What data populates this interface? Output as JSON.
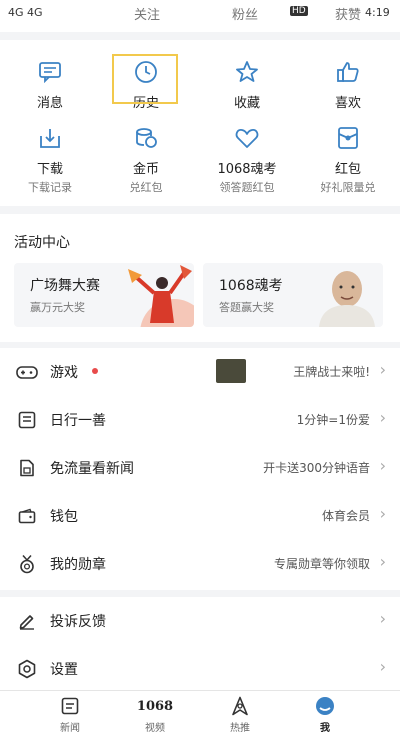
{
  "topbar": {
    "tabs": [
      "关注",
      "粉丝",
      "获赞"
    ],
    "status_left": "4G 4G",
    "status_right": "4:19",
    "hd": "HD"
  },
  "grid": {
    "row1": [
      {
        "label": "消息",
        "icon": "message-icon"
      },
      {
        "label": "历史",
        "icon": "clock-icon"
      },
      {
        "label": "收藏",
        "icon": "star-icon"
      },
      {
        "label": "喜欢",
        "icon": "thumbs-up-icon"
      }
    ],
    "row2": [
      {
        "label": "下载",
        "sub": "下载记录",
        "icon": "download-icon"
      },
      {
        "label": "金币",
        "sub": "兑红包",
        "icon": "coins-icon"
      },
      {
        "label": "1068魂考",
        "sub": "领答题红包",
        "icon": "heart-icon"
      },
      {
        "label": "红包",
        "sub": "好礼限量兑",
        "icon": "red-packet-icon"
      }
    ]
  },
  "activity": {
    "title": "活动中心",
    "cards": [
      {
        "title": "广场舞大赛",
        "sub": "赢万元大奖"
      },
      {
        "title": "1068魂考",
        "sub": "答题赢大奖"
      }
    ]
  },
  "list1": [
    {
      "label": "游戏",
      "value": "王牌战士来啦!",
      "icon": "gamepad-icon"
    },
    {
      "label": "日行一善",
      "value": "1分钟=1份爱",
      "icon": "charity-icon"
    },
    {
      "label": "免流量看新闻",
      "value": "开卡送300分钟语音",
      "icon": "sim-card-icon"
    },
    {
      "label": "钱包",
      "value": "体育会员",
      "icon": "wallet-icon"
    },
    {
      "label": "我的勋章",
      "value": "专属勋章等你领取",
      "icon": "medal-icon"
    }
  ],
  "list2": [
    {
      "label": "投诉反馈",
      "icon": "edit-icon"
    },
    {
      "label": "设置",
      "icon": "settings-icon"
    }
  ],
  "bottom_nav": [
    {
      "label": "新闻",
      "icon": "news-icon"
    },
    {
      "label": "视频",
      "icon": "video-1068-icon",
      "glyph": "1068"
    },
    {
      "label": "热推",
      "icon": "hot-icon"
    },
    {
      "label": "我",
      "icon": "me-icon"
    }
  ],
  "colors": {
    "accent": "#3b82c4",
    "bg": "#f3f4f6",
    "highlight": "#f2c94c"
  }
}
